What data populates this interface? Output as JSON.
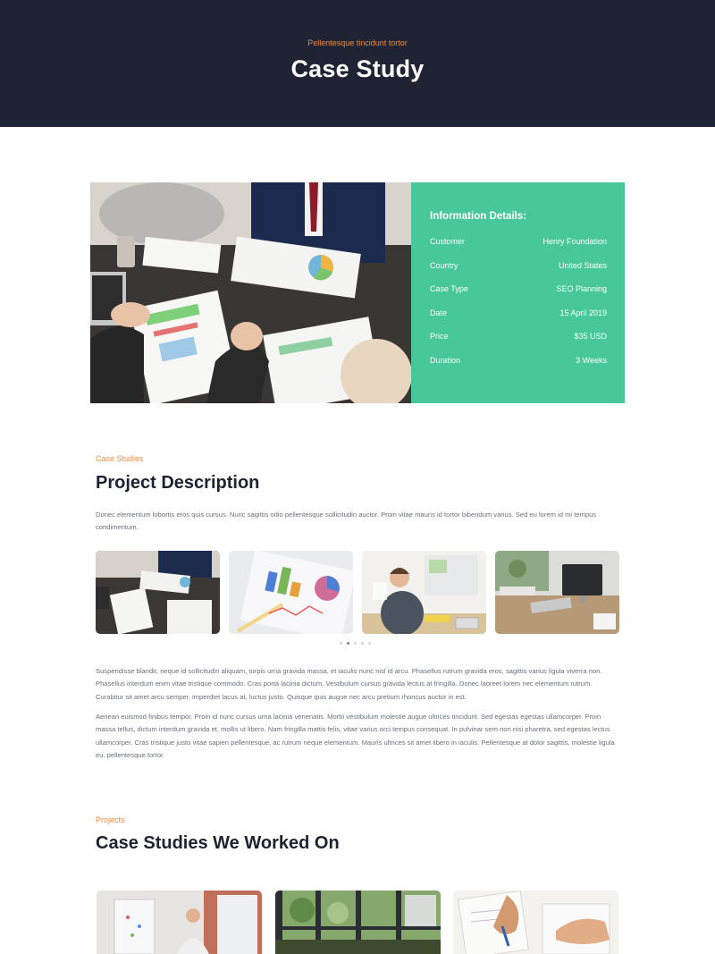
{
  "hero": {
    "eyebrow": "Pellentesque tincidunt tortor",
    "title": "Case Study"
  },
  "info": {
    "title": "Information Details:",
    "rows": [
      {
        "label": "Customer",
        "value": "Henry Foundation"
      },
      {
        "label": "Country",
        "value": "United States"
      },
      {
        "label": "Case Type",
        "value": "SEO Planning"
      },
      {
        "label": "Date",
        "value": "15 April 2019"
      },
      {
        "label": "Price",
        "value": "$35 USD"
      },
      {
        "label": "Duration",
        "value": "3 Weeks"
      }
    ]
  },
  "description": {
    "eyebrow": "Case Studies",
    "title": "Project Description",
    "intro": "Donec elementum lobortis eros quis cursus. Nunc sagittis odio pellentesque sollicitudin auctor. Proin vitae mauris id tortor bibendum varius. Sed eu lorem id mi tempus condimentum.",
    "body1": "Suspendisse blandit, neque id sollicitudin aliquam, turpis urna gravida massa, et iaculis nunc nisl id arcu. Phasellus rutrum gravida eros, sagittis varius ligula viverra non. Phasellus interdum enim vitae tristique commodo. Cras porta lacinia dictum. Vestibulum cursus gravida lectus at fringilla. Donec laoreet lorem nec elementum rutrum. Curabitur sit amet arcu semper, imperdiet lacus at, luctus justo. Quisque quis augue nec arcu pretium rhoncus auctor in est.",
    "body2": "Aenean euismod finibus tempor. Proin id nunc cursus urna lacinia venenatis. Morbi vestibulum molestie augue ultrices tincidunt. Sed egestas egestas ullamcorper. Proin massa tellus, dictum interdum gravida et, mollis ut libero. Nam fringilla mattis felis, vitae varius orci tempus consequat. In pulvinar sem non nisi pharetra, sed egestas lectus ullamcorper. Cras tristique justo vitae sapien pellentesque, ac rutrum neque elementum. Mauris ultrices sit amet libero in iaculis. Pellentesque at dolor sagittis, molestie ligula eu, pellentesque tortor."
  },
  "gallery": {
    "slide_count": 5,
    "active_slide": 2
  },
  "projects": {
    "eyebrow": "Projects",
    "title": "Case Studies We Worked On"
  },
  "colors": {
    "hero_bg": "#1f2333",
    "accent": "#f08a3c",
    "info_bg": "#48c79a",
    "heading": "#1d2130"
  }
}
